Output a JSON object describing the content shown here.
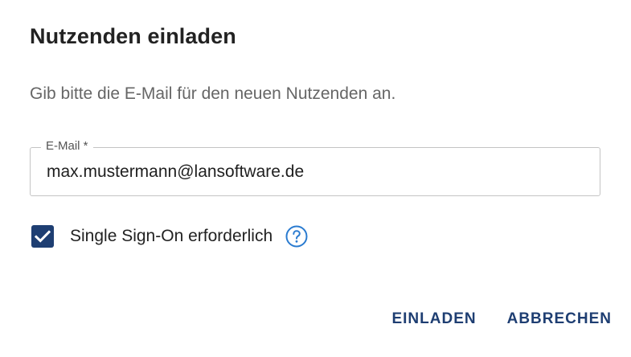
{
  "dialog": {
    "title": "Nutzenden einladen",
    "description": "Gib bitte die E-Mail für den neuen Nutzenden an.",
    "email_field": {
      "label": "E-Mail *",
      "value": "max.mustermann@lansoftware.de"
    },
    "sso": {
      "label": "Single Sign-On erforderlich",
      "checked": true,
      "help_icon": "question-circle-icon"
    },
    "actions": {
      "invite_label": "EINLADEN",
      "cancel_label": "ABBRECHEN"
    }
  },
  "colors": {
    "primary": "#1e3e72",
    "help_icon": "#2a7bd0",
    "text": "#222222",
    "muted_text": "#666666",
    "border": "#c4c4c4"
  }
}
